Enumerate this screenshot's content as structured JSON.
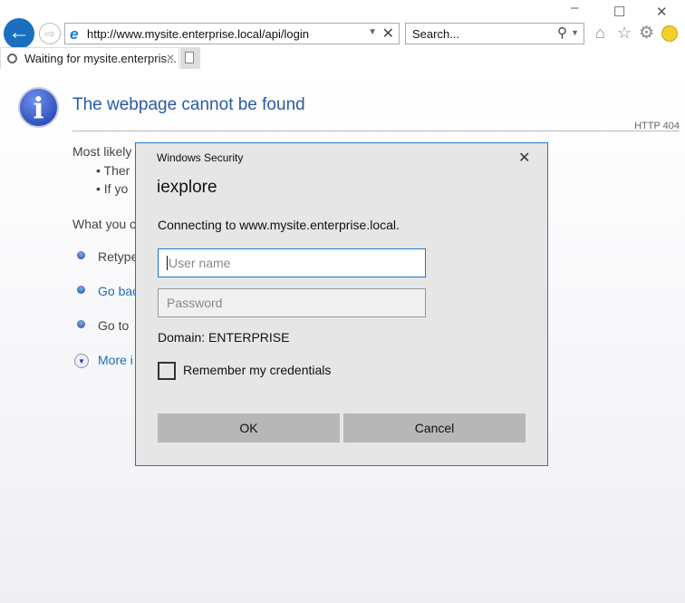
{
  "browser": {
    "url": "http://www.mysite.enterprise.local/api/login",
    "search_placeholder": "Search...",
    "tab_title": "Waiting for mysite.enterpris..."
  },
  "page": {
    "title": "The webpage cannot be found",
    "code": "HTTP 404",
    "most_likely": "Most likely",
    "bullets": [
      "Ther",
      "If yo"
    ],
    "what_you": "What you c",
    "actions": [
      "Retype",
      "Go bac",
      "Go to"
    ],
    "more": "More i"
  },
  "dialog": {
    "header": "Windows Security",
    "app": "iexplore",
    "connecting": "Connecting to www.mysite.enterprise.local.",
    "username_placeholder": "User name",
    "password_placeholder": "Password",
    "domain": "Domain: ENTERPRISE",
    "remember": "Remember my credentials",
    "ok": "OK",
    "cancel": "Cancel"
  }
}
